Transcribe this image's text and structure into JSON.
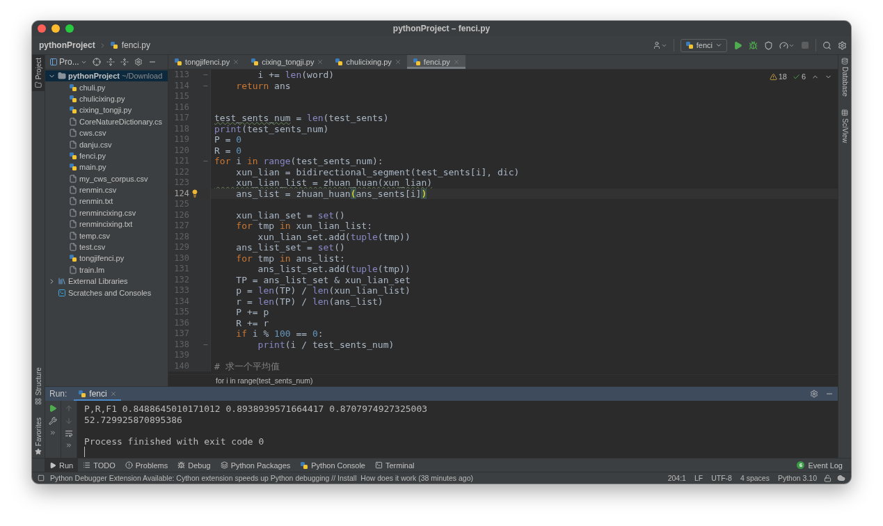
{
  "window": {
    "title": "pythonProject – fenci.py"
  },
  "breadcrumb": [
    {
      "label": "pythonProject",
      "kind": "project"
    },
    {
      "label": "fenci.py",
      "kind": "py"
    }
  ],
  "toolbar": {
    "run_config": "fenci"
  },
  "left_strip": [
    {
      "label": "Project",
      "selected": true,
      "kind": "project"
    },
    {
      "label": "Structure",
      "selected": false,
      "kind": "structure"
    },
    {
      "label": "Favorites",
      "selected": false,
      "kind": "favorites"
    }
  ],
  "right_strip": [
    {
      "label": "Database",
      "kind": "database"
    },
    {
      "label": "SciView",
      "kind": "sciview"
    }
  ],
  "project_panel": {
    "title": "Pro...",
    "root": {
      "label": "pythonProject",
      "path": "~/Download",
      "expanded": true,
      "selected": true,
      "children": [
        {
          "label": "chuli.py",
          "kind": "py",
          "selected": false
        },
        {
          "label": "chulicixing.py",
          "kind": "py",
          "selected": false
        },
        {
          "label": "cixing_tongji.py",
          "kind": "py",
          "selected": false
        },
        {
          "label": "CoreNatureDictionary.cs",
          "kind": "file",
          "selected": false
        },
        {
          "label": "cws.csv",
          "kind": "file",
          "selected": false
        },
        {
          "label": "danju.csv",
          "kind": "file",
          "selected": false
        },
        {
          "label": "fenci.py",
          "kind": "py",
          "selected": false
        },
        {
          "label": "main.py",
          "kind": "py",
          "selected": false
        },
        {
          "label": "my_cws_corpus.csv",
          "kind": "file",
          "selected": false
        },
        {
          "label": "renmin.csv",
          "kind": "file",
          "selected": false
        },
        {
          "label": "renmin.txt",
          "kind": "file",
          "selected": false
        },
        {
          "label": "renmincixing.csv",
          "kind": "file",
          "selected": false
        },
        {
          "label": "renmincixing.txt",
          "kind": "file",
          "selected": false
        },
        {
          "label": "temp.csv",
          "kind": "file",
          "selected": false
        },
        {
          "label": "test.csv",
          "kind": "file",
          "selected": false
        },
        {
          "label": "tongjifenci.py",
          "kind": "py",
          "selected": false
        },
        {
          "label": "train.lm",
          "kind": "file",
          "selected": false
        }
      ]
    },
    "others": [
      {
        "label": "External Libraries",
        "kind": "libraries",
        "expanded": false,
        "selected": false
      },
      {
        "label": "Scratches and Consoles",
        "kind": "scratches",
        "selected": false
      }
    ]
  },
  "editor_tabs": [
    {
      "label": "tongjifenci.py",
      "selected": false
    },
    {
      "label": "cixing_tongji.py",
      "selected": false
    },
    {
      "label": "chulicixing.py",
      "selected": false
    },
    {
      "label": "fenci.py",
      "selected": true
    }
  ],
  "inspections": {
    "warnings": "18",
    "weak_warnings": "6"
  },
  "code_lines": [
    {
      "number": "113",
      "current": false,
      "fold": true,
      "tokens": [
        {
          "kind": "plain",
          "text": "        i += "
        },
        {
          "kind": "builtin",
          "text": "len"
        },
        {
          "kind": "plain",
          "text": "(word)"
        }
      ]
    },
    {
      "number": "114",
      "current": false,
      "fold": true,
      "tokens": [
        {
          "kind": "kw",
          "text": "    return"
        },
        {
          "kind": "plain",
          "text": " ans"
        }
      ]
    },
    {
      "number": "115",
      "current": false,
      "fold": false
    },
    {
      "number": "116",
      "current": false,
      "fold": false
    },
    {
      "number": "117",
      "current": false,
      "fold": false,
      "tokens": [
        {
          "kind": "weak",
          "text": "test_sents_num"
        },
        {
          "kind": "plain",
          "text": " = "
        },
        {
          "kind": "builtin",
          "text": "len"
        },
        {
          "kind": "plain",
          "text": "(test_sents)"
        }
      ]
    },
    {
      "number": "118",
      "current": false,
      "fold": false,
      "tokens": [
        {
          "kind": "builtin",
          "text": "print"
        },
        {
          "kind": "plain",
          "text": "(test_sents_num)"
        }
      ]
    },
    {
      "number": "119",
      "current": false,
      "fold": false,
      "tokens": [
        {
          "kind": "plain",
          "text": "P = "
        },
        {
          "kind": "num",
          "text": "0"
        }
      ]
    },
    {
      "number": "120",
      "current": false,
      "fold": false,
      "tokens": [
        {
          "kind": "plain",
          "text": "R = "
        },
        {
          "kind": "num",
          "text": "0"
        }
      ]
    },
    {
      "number": "121",
      "current": false,
      "fold": true,
      "tokens": [
        {
          "kind": "kw",
          "text": "for"
        },
        {
          "kind": "plain",
          "text": " i "
        },
        {
          "kind": "kw",
          "text": "in"
        },
        {
          "kind": "builtin",
          "text": " range"
        },
        {
          "kind": "plain",
          "text": "(test_sents_num):"
        }
      ]
    },
    {
      "number": "122",
      "current": false,
      "fold": false,
      "tokens": [
        {
          "kind": "plain",
          "text": "    xun_lian = bidirectional_segment(test_sents[i], dic)"
        }
      ]
    },
    {
      "number": "123",
      "current": false,
      "fold": false,
      "tokens": [
        {
          "kind": "weak",
          "text": "    xun_lian_list = zhuan_huan(xun_lian)"
        }
      ]
    },
    {
      "number": "124",
      "current": true,
      "fold": false,
      "tokens": [
        {
          "kind": "plain",
          "text": "    ans_list = zhuan_huan"
        },
        {
          "kind": "match",
          "text": "("
        },
        {
          "kind": "plain",
          "text": "ans_sents[i]"
        },
        {
          "kind": "match",
          "text": ")"
        }
      ]
    },
    {
      "number": "125",
      "current": false,
      "fold": false
    },
    {
      "number": "126",
      "current": false,
      "fold": false,
      "tokens": [
        {
          "kind": "plain",
          "text": "    xun_lian_set = "
        },
        {
          "kind": "builtin",
          "text": "set"
        },
        {
          "kind": "plain",
          "text": "()"
        }
      ]
    },
    {
      "number": "127",
      "current": false,
      "fold": false,
      "tokens": [
        {
          "kind": "kw",
          "text": "    for"
        },
        {
          "kind": "plain",
          "text": " tmp "
        },
        {
          "kind": "kw",
          "text": "in"
        },
        {
          "kind": "plain",
          "text": " xun_lian_list:"
        }
      ]
    },
    {
      "number": "128",
      "current": false,
      "fold": false,
      "tokens": [
        {
          "kind": "plain",
          "text": "        xun_lian_set.add("
        },
        {
          "kind": "builtin",
          "text": "tuple"
        },
        {
          "kind": "plain",
          "text": "(tmp))"
        }
      ]
    },
    {
      "number": "129",
      "current": false,
      "fold": false,
      "tokens": [
        {
          "kind": "plain",
          "text": "    ans_list_set = "
        },
        {
          "kind": "builtin",
          "text": "set"
        },
        {
          "kind": "plain",
          "text": "()"
        }
      ]
    },
    {
      "number": "130",
      "current": false,
      "fold": false,
      "tokens": [
        {
          "kind": "kw",
          "text": "    for"
        },
        {
          "kind": "plain",
          "text": " tmp "
        },
        {
          "kind": "kw",
          "text": "in"
        },
        {
          "kind": "plain",
          "text": " ans_list:"
        }
      ]
    },
    {
      "number": "131",
      "current": false,
      "fold": false,
      "tokens": [
        {
          "kind": "plain",
          "text": "        ans_list_set.add("
        },
        {
          "kind": "builtin",
          "text": "tuple"
        },
        {
          "kind": "plain",
          "text": "(tmp))"
        }
      ]
    },
    {
      "number": "132",
      "current": false,
      "fold": false,
      "tokens": [
        {
          "kind": "plain",
          "text": "    TP = ans_list_set & xun_lian_set"
        }
      ]
    },
    {
      "number": "133",
      "current": false,
      "fold": false,
      "tokens": [
        {
          "kind": "plain",
          "text": "    p = "
        },
        {
          "kind": "builtin",
          "text": "len"
        },
        {
          "kind": "plain",
          "text": "(TP) / "
        },
        {
          "kind": "builtin",
          "text": "len"
        },
        {
          "kind": "plain",
          "text": "(xun_lian_list)"
        }
      ]
    },
    {
      "number": "134",
      "current": false,
      "fold": false,
      "tokens": [
        {
          "kind": "plain",
          "text": "    r = "
        },
        {
          "kind": "builtin",
          "text": "len"
        },
        {
          "kind": "plain",
          "text": "(TP) / "
        },
        {
          "kind": "builtin",
          "text": "len"
        },
        {
          "kind": "plain",
          "text": "(ans_list)"
        }
      ]
    },
    {
      "number": "135",
      "current": false,
      "fold": false,
      "tokens": [
        {
          "kind": "plain",
          "text": "    P += p"
        }
      ]
    },
    {
      "number": "136",
      "current": false,
      "fold": false,
      "tokens": [
        {
          "kind": "plain",
          "text": "    R += r"
        }
      ]
    },
    {
      "number": "137",
      "current": false,
      "fold": false,
      "tokens": [
        {
          "kind": "kw",
          "text": "    if"
        },
        {
          "kind": "plain",
          "text": " i % "
        },
        {
          "kind": "num",
          "text": "100"
        },
        {
          "kind": "plain",
          "text": " == "
        },
        {
          "kind": "num",
          "text": "0"
        },
        {
          "kind": "plain",
          "text": ":"
        }
      ]
    },
    {
      "number": "138",
      "current": false,
      "fold": true,
      "tokens": [
        {
          "kind": "builtin",
          "text": "        print"
        },
        {
          "kind": "plain",
          "text": "(i / test_sents_num)"
        }
      ]
    },
    {
      "number": "139",
      "current": false,
      "fold": false
    },
    {
      "number": "140",
      "current": false,
      "fold": false,
      "tokens": [
        {
          "kind": "comment",
          "text": "# 求一个平均值"
        }
      ]
    }
  ],
  "context_hint": "for i in range(test_sents_num)",
  "run_panel": {
    "title": "Run:",
    "tab": "fenci",
    "output": [
      {
        "kind": "stdout",
        "text": "P,R,F1 0.8488645010171012 0.8938939571664417 0.8707974927325003"
      },
      {
        "kind": "stdout",
        "text": "52.729925870895386"
      },
      {
        "kind": "status",
        "text": "Process finished with exit code 0"
      }
    ]
  },
  "tool_tabs": [
    {
      "label": "Run",
      "kind": "run",
      "selected": true
    },
    {
      "label": "TODO",
      "kind": "todo",
      "selected": false
    },
    {
      "label": "Problems",
      "kind": "problems",
      "selected": false
    },
    {
      "label": "Debug",
      "kind": "debug",
      "selected": false
    },
    {
      "label": "Python Packages",
      "kind": "packages",
      "selected": false
    },
    {
      "label": "Python Console",
      "kind": "console",
      "selected": false
    },
    {
      "label": "Terminal",
      "kind": "terminal",
      "selected": false
    }
  ],
  "event_log": {
    "label": "Event Log",
    "count": "6"
  },
  "status_bar": {
    "message": "Python Debugger Extension Available: Cython extension speeds up Python debugging // Install  How does it work (38 minutes ago)",
    "items": [
      "204:1",
      "LF",
      "UTF-8",
      "4 spaces",
      "Python 3.10"
    ]
  }
}
